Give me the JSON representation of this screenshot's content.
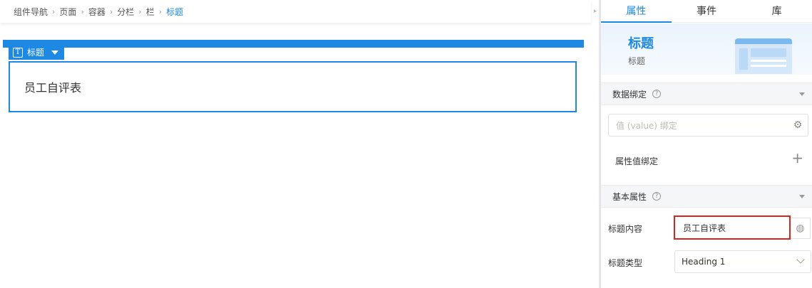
{
  "breadcrumb": {
    "items": [
      "组件导航",
      "页面",
      "容器",
      "分栏",
      "栏",
      "标题"
    ],
    "separator": ">"
  },
  "canvas": {
    "selection_tag": "标题",
    "selection_tag_icon": "T",
    "heading_text": "员工自评表"
  },
  "panel": {
    "tabs": [
      "属性",
      "事件",
      "库"
    ],
    "active_tab": "属性",
    "hero": {
      "title": "标题",
      "subtitle": "标题"
    },
    "data_binding": {
      "header": "数据绑定",
      "value_placeholder": "值 (value) 绑定",
      "attr_binding_label": "属性值绑定",
      "plus_glyph": "+"
    },
    "basic_props": {
      "header": "基本属性",
      "title_content_label": "标题内容",
      "title_content_value": "员工自评表",
      "title_type_label": "标题类型",
      "title_type_value": "Heading 1"
    }
  },
  "colors": {
    "accent": "#1e88e5",
    "highlight_border": "#d9261c"
  }
}
